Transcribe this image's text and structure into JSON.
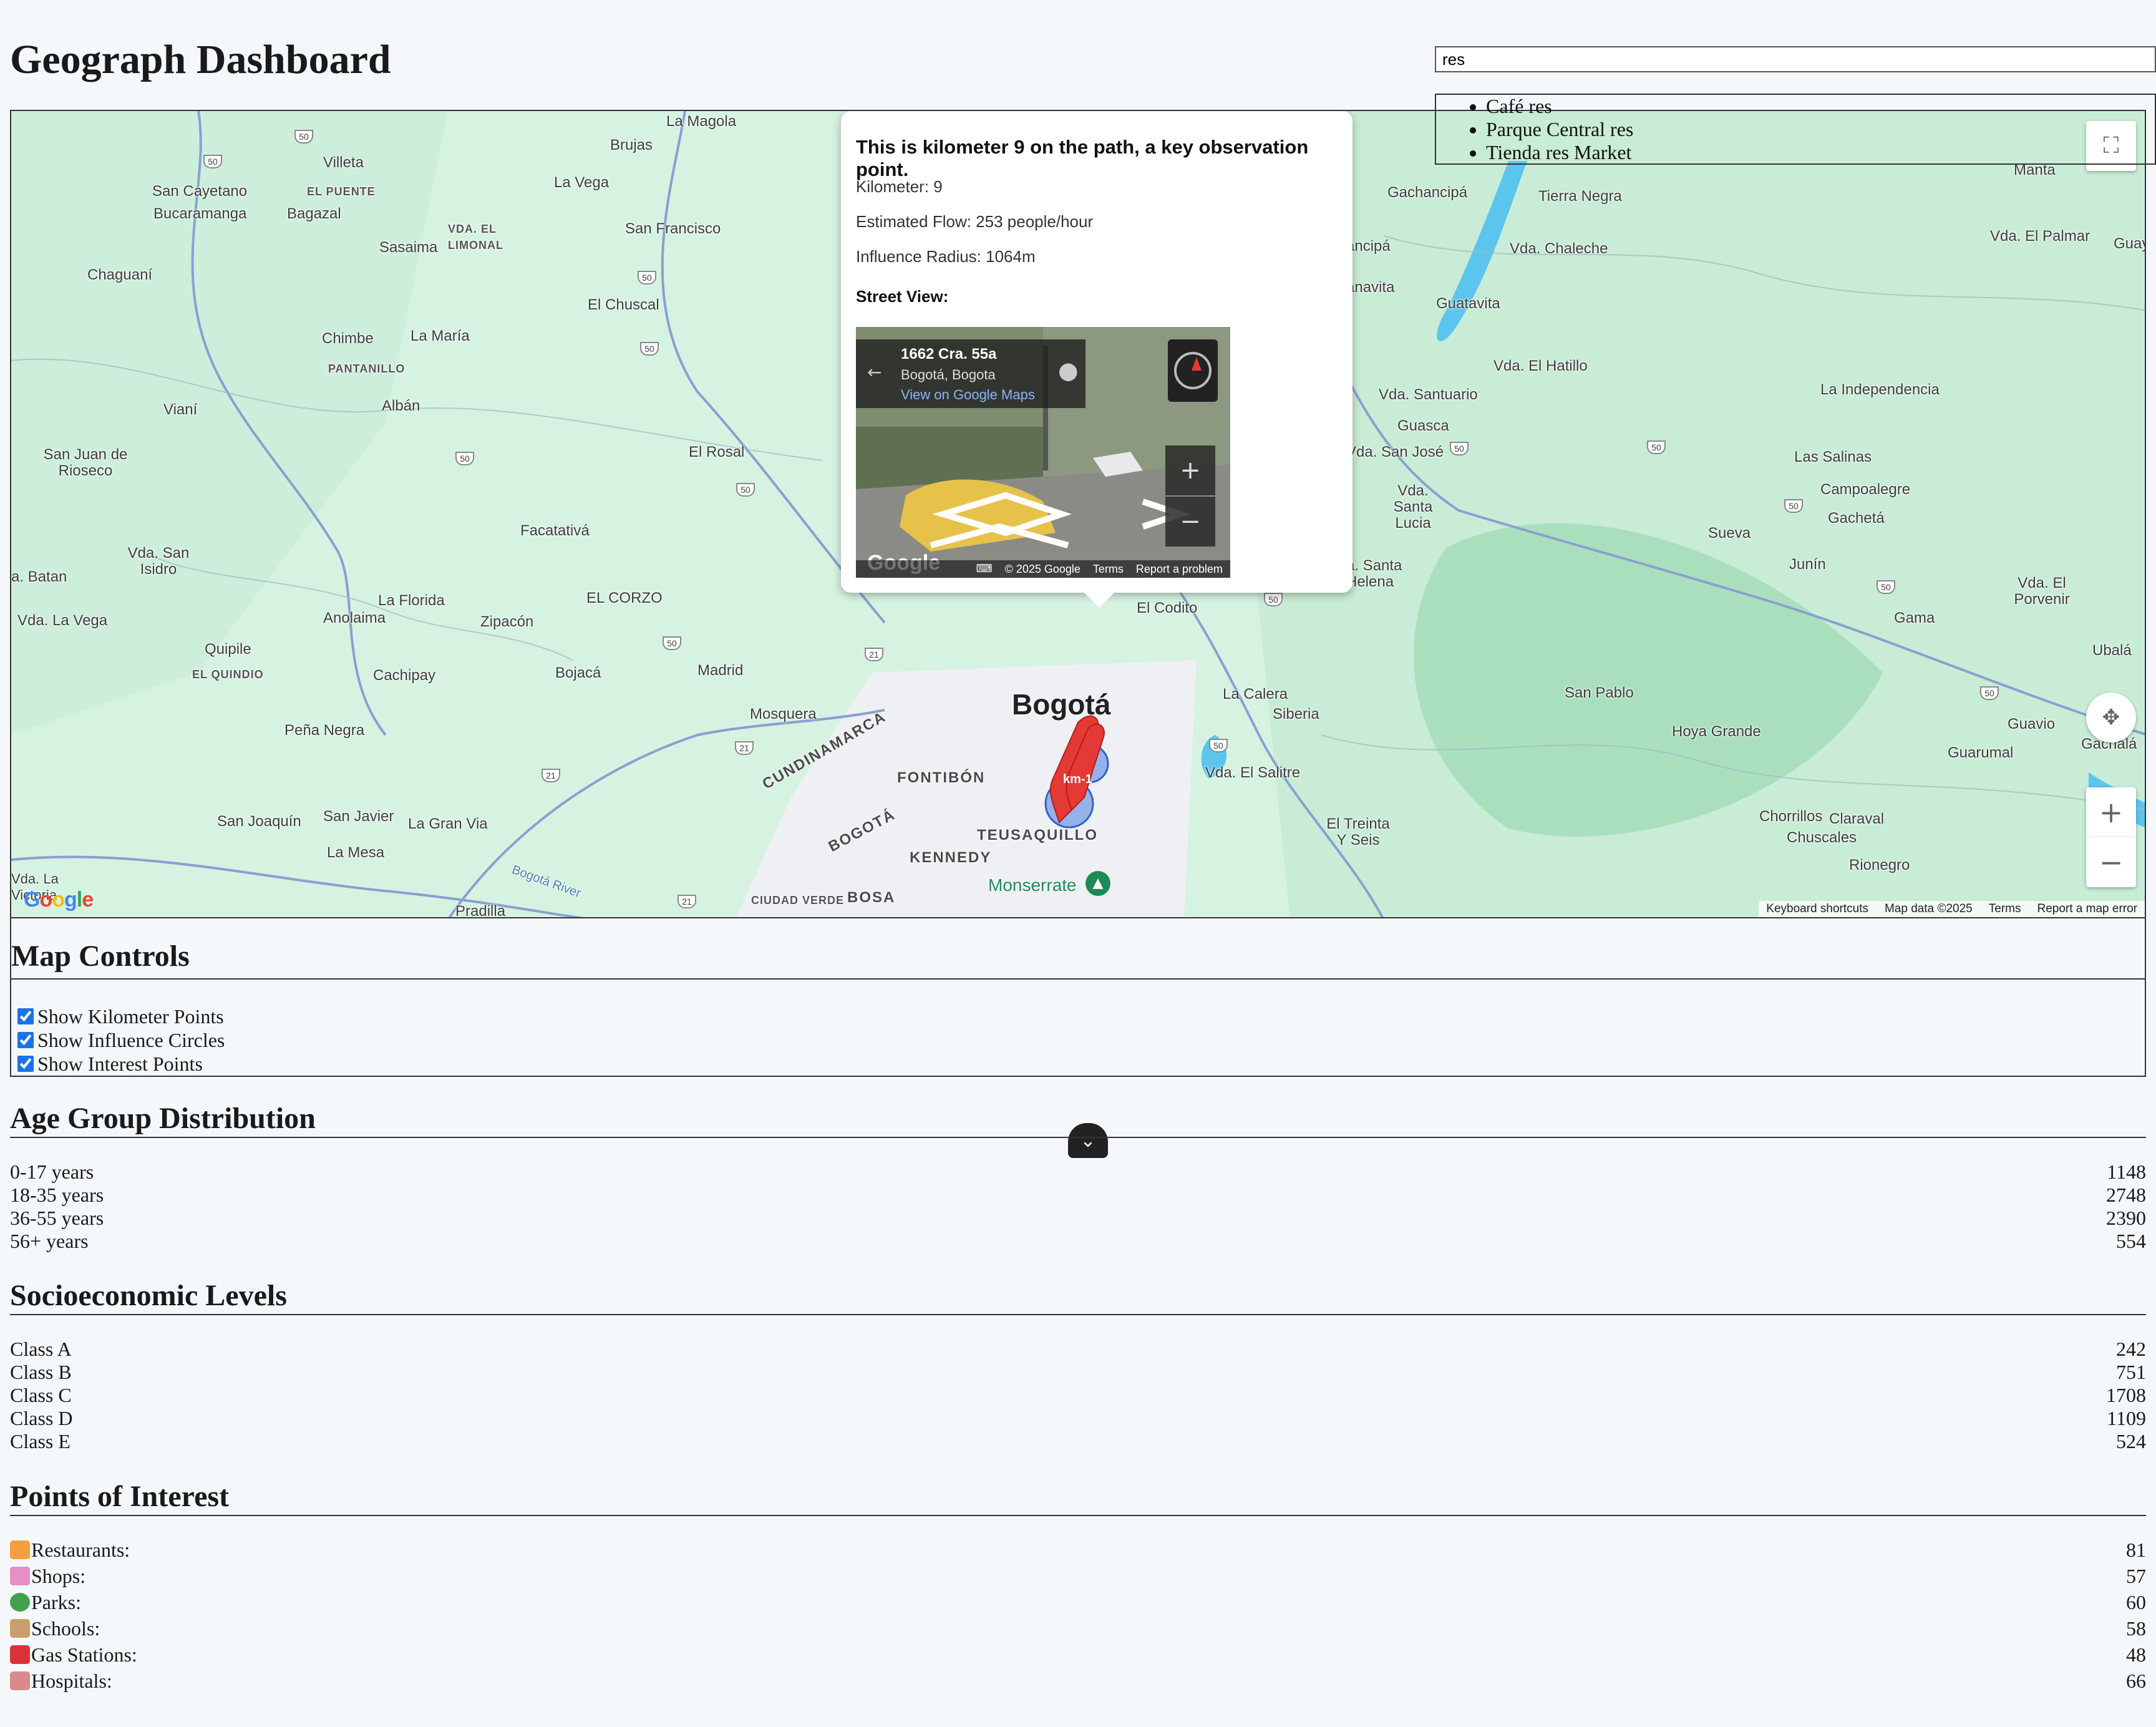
{
  "header": {
    "title": "Geograph Dashboard",
    "search_value": "res",
    "suggestions": [
      "Café res",
      "Parque Central res",
      "Tienda res Market"
    ]
  },
  "map": {
    "places": {
      "la_magola": "La Magola",
      "brujas": "Brujas",
      "villeta": "Villeta",
      "san_cayetano": "San Cayetano",
      "el_puente": "EL PUENTE",
      "bucaramanga": "Bucaramanga",
      "bagazal": "Bagazal",
      "la_vega": "La Vega",
      "vda_el_limonal": "VDA. EL LIMONAL",
      "sasaima": "Sasaima",
      "san_francisco": "San Francisco",
      "chaguani": "Chaguaní",
      "el_chuscal": "El Chuscal",
      "chimbe": "Chimbe",
      "la_maria": "La María",
      "pantanillo": "PANTANILLO",
      "viani": "Vianí",
      "alban": "Albán",
      "san_juan": "San Juan de Rioseco",
      "el_rosal": "El Rosal",
      "facatativa": "Facatativá",
      "vda_san_isidro": "Vda. San Isidro",
      "batan": "a. Batan",
      "la_florida": "La Florida",
      "el_corzo": "EL CORZO",
      "vda_la_vega": "Vda. La Vega",
      "anolaima": "Anolaima",
      "zipacon": "Zipacón",
      "quipile": "Quipile",
      "el_quindio": "EL QUINDIO",
      "cachipay": "Cachipay",
      "bojaca": "Bojacá",
      "madrid": "Madrid",
      "mosquera": "Mosquera",
      "pena_negra": "Peña Negra",
      "cundinamarca": "CUNDINAMARCA",
      "fontibon": "FONTIBÓN",
      "bogota_city": "Bogotá",
      "bogota_district": "BOGOTÁ",
      "teusaquillo": "TEUSAQUILLO",
      "kennedy": "KENNEDY",
      "san_joaquin": "San Joaquín",
      "san_javier": "San Javier",
      "la_gran_via": "La Gran Via",
      "la_mesa": "La Mesa",
      "vda_la_victoria": "Vda. La Victoria",
      "pradilla": "Pradilla",
      "bogota_river": "Bogotá River",
      "ciudad_verde": "CIUDAD VERDE",
      "bosa": "BOSA",
      "monserrate": "Monserrate",
      "el_codito": "El Codito",
      "la_calera": "La Calera",
      "siberia": "Siberia",
      "vda_el_salitre": "Vda. El Salitre",
      "el_treinta": "El Treinta Y Seis",
      "gachancipa": "Gachancipá",
      "tierra_negra": "Tierra Negra",
      "vda_chaleche": "Vda. Chaleche",
      "guatavita": "Guatavita",
      "vda_el_hatillo": "Vda. El Hatillo",
      "vda_santuario": "Vda. Santuario",
      "guasca": "Guasca",
      "vda_san_jose": "Vda. San José",
      "vda_santa_lucia": "Vda. Santa Lucia",
      "santa_helena": "a. Santa Helena",
      "la_independencia": "La Independencia",
      "las_salinas": "Las Salinas",
      "campoalegre": "Campoalegre",
      "gacheta": "Gachetá",
      "sueva": "Sueva",
      "junin": "Junín",
      "vda_el_palmar": "Vda. El Palmar",
      "manta": "Manta",
      "guayata": "Guayatá",
      "gama": "Gama",
      "vda_el_porvenir": "Vda. El Porvenir",
      "ubala": "Ubalá",
      "san_pablo": "San Pablo",
      "hoya_grande": "Hoya Grande",
      "guavio": "Guavio",
      "gachala": "Gachalá",
      "guarumal": "Guarumal",
      "chorrillos": "Chorrillos",
      "claraval": "Claraval",
      "chuscales": "Chuscales",
      "rionegro": "Rionegro",
      "anancipa": "ancipá",
      "anavita": "anavita"
    },
    "route_number": "50",
    "route_number_21": "21",
    "footer": [
      "Keyboard shortcuts",
      "Map data ©2025",
      "Terms",
      "Report a map error"
    ],
    "logo": "Google",
    "marker_label": "km-1"
  },
  "infowindow": {
    "title": "This is kilometer 9 on the path, a key observation point.",
    "kilometer": "Kilometer: 9",
    "flow": "Estimated Flow: 253 people/hour",
    "radius": "Influence Radius: 1064m",
    "street_view_label": "Street View:",
    "street_view": {
      "address": "1662 Cra. 55a",
      "city": "Bogotá, Bogota",
      "link": "View on Google Maps",
      "logo": "Google",
      "footer": [
        "© 2025 Google",
        "Terms",
        "Report a problem"
      ]
    }
  },
  "controls": {
    "title": "Map Controls",
    "options": [
      {
        "label": "Show Kilometer Points",
        "checked": true
      },
      {
        "label": "Show Influence Circles",
        "checked": true
      },
      {
        "label": "Show Interest Points",
        "checked": true
      }
    ]
  },
  "age": {
    "title": "Age Group Distribution",
    "rows": [
      {
        "label": "0-17 years",
        "value": "1148"
      },
      {
        "label": "18-35 years",
        "value": "2748"
      },
      {
        "label": "36-55 years",
        "value": "2390"
      },
      {
        "label": "56+ years",
        "value": "554"
      }
    ]
  },
  "socio": {
    "title": "Socioeconomic Levels",
    "rows": [
      {
        "label": "Class A",
        "value": "242"
      },
      {
        "label": "Class B",
        "value": "751"
      },
      {
        "label": "Class C",
        "value": "1708"
      },
      {
        "label": "Class D",
        "value": "1109"
      },
      {
        "label": "Class E",
        "value": "524"
      }
    ]
  },
  "poi": {
    "title": "Points of Interest",
    "rows": [
      {
        "label": "Restaurants:",
        "value": "81",
        "icon": "burger-icon"
      },
      {
        "label": "Shops:",
        "value": "57",
        "icon": "shopping-bag-icon"
      },
      {
        "label": "Parks:",
        "value": "60",
        "icon": "tree-icon"
      },
      {
        "label": "Schools:",
        "value": "58",
        "icon": "school-icon"
      },
      {
        "label": "Gas Stations:",
        "value": "48",
        "icon": "fuel-pump-icon"
      },
      {
        "label": "Hospitals:",
        "value": "66",
        "icon": "hospital-icon"
      }
    ]
  },
  "colors": {
    "map_green": "#d6f3e2",
    "lake": "#5cc5ee",
    "marker_red": "#e53935",
    "circle_blue": "#4a7fe0"
  }
}
